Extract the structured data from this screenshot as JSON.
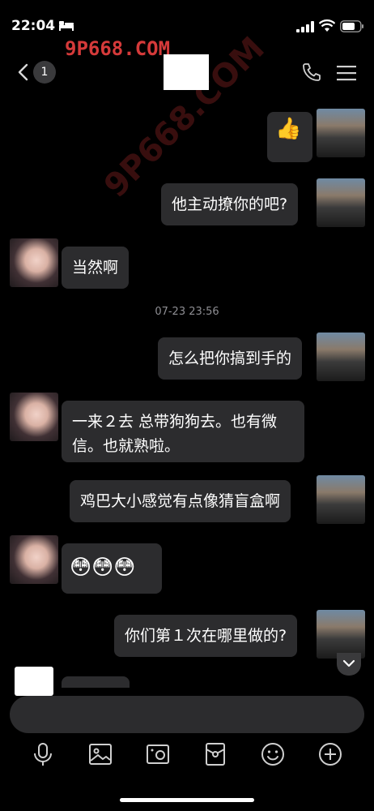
{
  "status_bar": {
    "time": "22:04",
    "icons": [
      "bed-icon",
      "signal-icon",
      "wifi-icon",
      "battery-icon"
    ]
  },
  "watermark": {
    "top_text": "9P668.COM",
    "diagonal_text": "9P668.COM"
  },
  "nav": {
    "back_icon": "chevron-left-icon",
    "unread_count": "1",
    "call_icon": "phone-icon",
    "menu_icon": "hamburger-menu-icon"
  },
  "messages": [
    {
      "from": "me",
      "type": "emoji",
      "text": "👍"
    },
    {
      "from": "me",
      "type": "text",
      "text": "他主动撩你的吧?"
    },
    {
      "from": "her",
      "type": "text",
      "text": "当然啊"
    },
    {
      "from": "me",
      "type": "text",
      "text": "怎么把你搞到手的"
    },
    {
      "from": "her",
      "type": "text",
      "text": "一来２去 总带狗狗去。也有微信。也就熟啦。"
    },
    {
      "from": "me",
      "type": "text",
      "text": "鸡巴大小感觉有点像猜盲盒啊"
    },
    {
      "from": "her",
      "type": "emoji",
      "text": "😳😳😳"
    },
    {
      "from": "me",
      "type": "text",
      "text": "你们第１次在哪里做的?"
    }
  ],
  "timestamp": "07-23 23:56",
  "toolbar": {
    "items": [
      "microphone-icon",
      "image-icon",
      "camera-icon",
      "red-packet-icon",
      "emoji-icon",
      "plus-icon"
    ]
  },
  "colors": {
    "background": "#000000",
    "bubble": "#2c2c2e",
    "timestamp": "#8e8e93",
    "watermark": "#d53a3a"
  }
}
